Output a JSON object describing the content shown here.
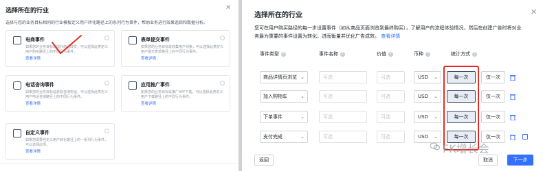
{
  "left_dialog": {
    "title": "选择所在的行业",
    "close": "✕",
    "description": "选择与您的业务目标相同的行业模板定义用户转化路径上的系列行为事件，帮助业务进行效果追踪和数据分析。",
    "cards": [
      {
        "title": "电商事件",
        "desc1": "如果您的业务目标是提升商品成交，可以选择此类定义",
        "desc2": "用户购买路径上的不同行为事件。",
        "link": "查看详情",
        "icon": "storefront-icon"
      },
      {
        "title": "表单提交事件",
        "desc1": "如果您的业务目标是收集用户线索，可以选择此类定义",
        "desc2": "用户提交表单路径上的不同行为事件。",
        "link": "查看详情",
        "icon": "table-icon"
      },
      {
        "title": "电话咨询事件",
        "desc1": "如果您的业务目标是获取咨询电话，可以选择此类定义",
        "desc2": "用户电话咨询路径上的不同行为事件。",
        "link": "查看详情",
        "icon": "chat-icon"
      },
      {
        "title": "应用推广事件",
        "desc1": "如果您的业务目标是推广APP下载，可以选择此类定义",
        "desc2": "用户下载路径上的不同行为事件。",
        "link": "查看详情",
        "icon": "app-icon"
      },
      {
        "title": "自定义事件",
        "desc1": "如果您需要自定义用户转化路径上的一系列行为事件，",
        "desc2": "可以选择此项。",
        "link": "查看详情",
        "icon": "custom-icon"
      }
    ]
  },
  "right_dialog": {
    "title": "选择所在的行业",
    "close": "✕",
    "desc_line1": "您可在用户购买路径的每一步设置事件（如从商品页面浏览到最终购买），了解用户的流程体验情况，然后在创建广告时将对业",
    "desc_line2": "务最为重要的事件设置为转化，进而衡量并优化广告成效。",
    "desc_link": "查看详情",
    "headers": {
      "event_type": "事件类型",
      "event_name": "事件名称",
      "value": "价值",
      "currency": "币种",
      "counting": "统计方式"
    },
    "placeholder_optional": "可选",
    "rows": [
      {
        "event_type": "商品详情页浏览",
        "currency": "USD",
        "count_each": "每一次",
        "count_once": "仅一次"
      },
      {
        "event_type": "加入购物车",
        "currency": "USD",
        "count_each": "每一次",
        "count_once": "仅一次"
      },
      {
        "event_type": "下单事件",
        "currency": "USD",
        "count_each": "每一次",
        "count_once": "仅一次"
      },
      {
        "event_type": "支付完成",
        "currency": "USD",
        "count_each": "每一次",
        "count_once": "仅一次"
      }
    ],
    "back": "返回",
    "cancel": "取消",
    "next": "下一步"
  },
  "watermark": "FK增长会",
  "colors": {
    "accent": "#3370ff",
    "highlight": "#e02e24",
    "selected_bg": "#e8ecf5"
  }
}
